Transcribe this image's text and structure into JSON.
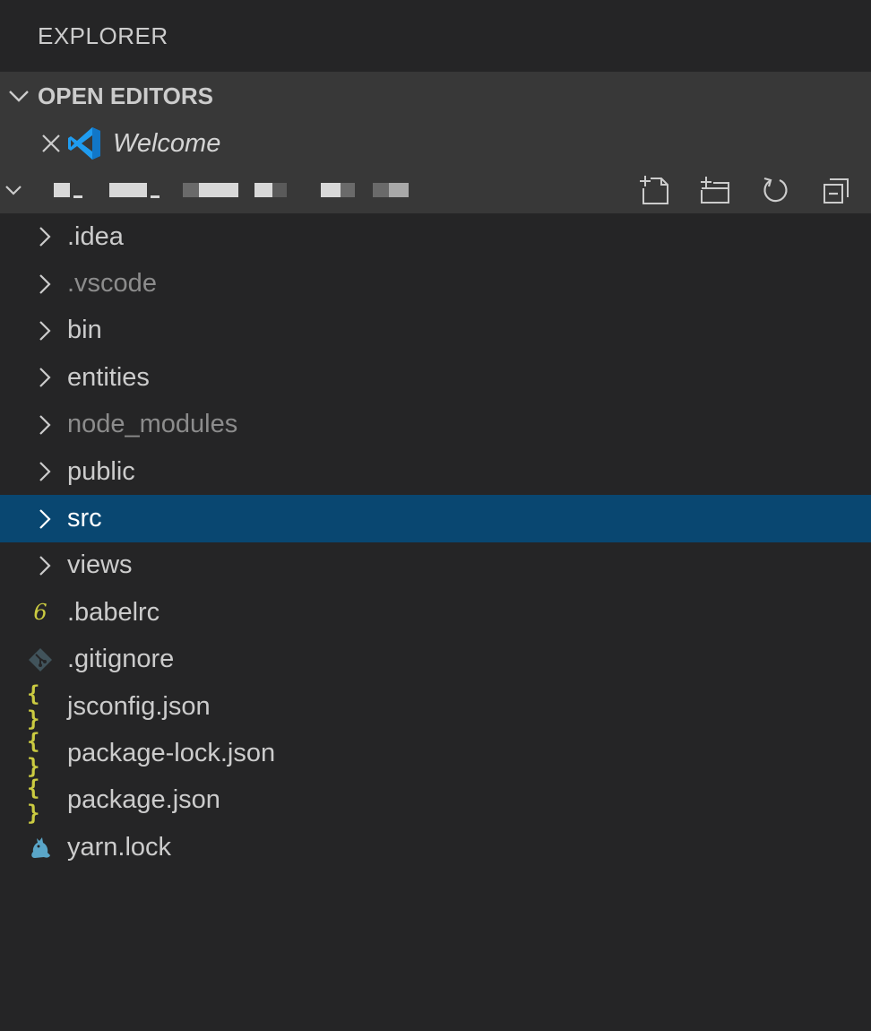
{
  "explorer": {
    "title": "EXPLORER"
  },
  "open_editors": {
    "header": "OPEN EDITORS",
    "items": [
      {
        "label": "Welcome"
      }
    ]
  },
  "folder": {
    "actions": [
      "new-file-icon",
      "new-folder-icon",
      "refresh-icon",
      "collapse-all-icon"
    ]
  },
  "tree": {
    "folders": [
      {
        "label": ".idea",
        "dimmed": false
      },
      {
        "label": ".vscode",
        "dimmed": true
      },
      {
        "label": "bin",
        "dimmed": false
      },
      {
        "label": "entities",
        "dimmed": false
      },
      {
        "label": "node_modules",
        "dimmed": true
      },
      {
        "label": "public",
        "dimmed": false
      },
      {
        "label": "src",
        "selected": true
      },
      {
        "label": "views",
        "dimmed": false
      }
    ],
    "files": [
      {
        "label": ".babelrc",
        "icon": "babel-icon"
      },
      {
        "label": ".gitignore",
        "icon": "git-icon"
      },
      {
        "label": "jsconfig.json",
        "icon": "json-icon"
      },
      {
        "label": "package-lock.json",
        "icon": "json-icon"
      },
      {
        "label": "package.json",
        "icon": "json-icon"
      },
      {
        "label": "yarn.lock",
        "icon": "yarn-icon"
      }
    ]
  },
  "colors": {
    "background": "#252526",
    "header_bg": "#383838",
    "selected_bg": "#094771",
    "json_yellow": "#cbcb41",
    "vscode_blue": "#1f9cf0"
  }
}
